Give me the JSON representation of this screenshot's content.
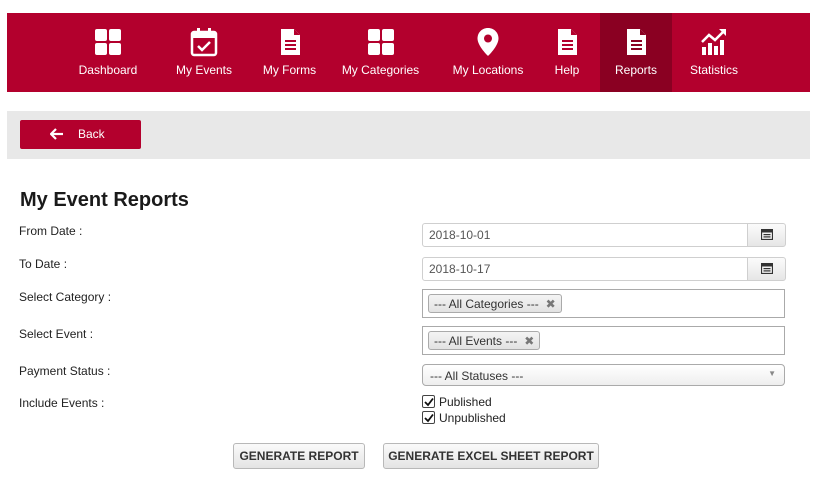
{
  "nav": {
    "items": [
      {
        "label": "Dashboard",
        "icon": "dashboard-grid-icon"
      },
      {
        "label": "My Events",
        "icon": "calendar-check-icon"
      },
      {
        "label": "My Forms",
        "icon": "form-document-icon"
      },
      {
        "label": "My Categories",
        "icon": "categories-grid-icon"
      },
      {
        "label": "My Locations",
        "icon": "map-pin-icon"
      },
      {
        "label": "Help",
        "icon": "help-document-icon"
      },
      {
        "label": "Reports",
        "icon": "report-document-icon",
        "active": true
      },
      {
        "label": "Statistics",
        "icon": "statistics-chart-icon"
      }
    ]
  },
  "toolbar": {
    "back_label": "Back"
  },
  "page": {
    "title": "My Event Reports"
  },
  "form": {
    "from_date": {
      "label": "From Date :",
      "value": "2018-10-01"
    },
    "to_date": {
      "label": "To Date :",
      "value": "2018-10-17"
    },
    "category": {
      "label": "Select Category :",
      "selected": "--- All Categories ---",
      "remove_glyph": "✖"
    },
    "event": {
      "label": "Select Event :",
      "selected": "--- All Events ---",
      "remove_glyph": "✖"
    },
    "payment_status": {
      "label": "Payment Status :",
      "selected": "--- All Statuses ---"
    },
    "include_events": {
      "label": "Include Events :",
      "options": [
        {
          "label": "Published",
          "checked": true
        },
        {
          "label": "Unpublished",
          "checked": true
        }
      ]
    }
  },
  "actions": {
    "generate_report": "GENERATE REPORT",
    "generate_excel": "GENERATE EXCEL SHEET REPORT"
  },
  "colors": {
    "brand": "#b3002d",
    "brand_active": "#8a0022"
  }
}
